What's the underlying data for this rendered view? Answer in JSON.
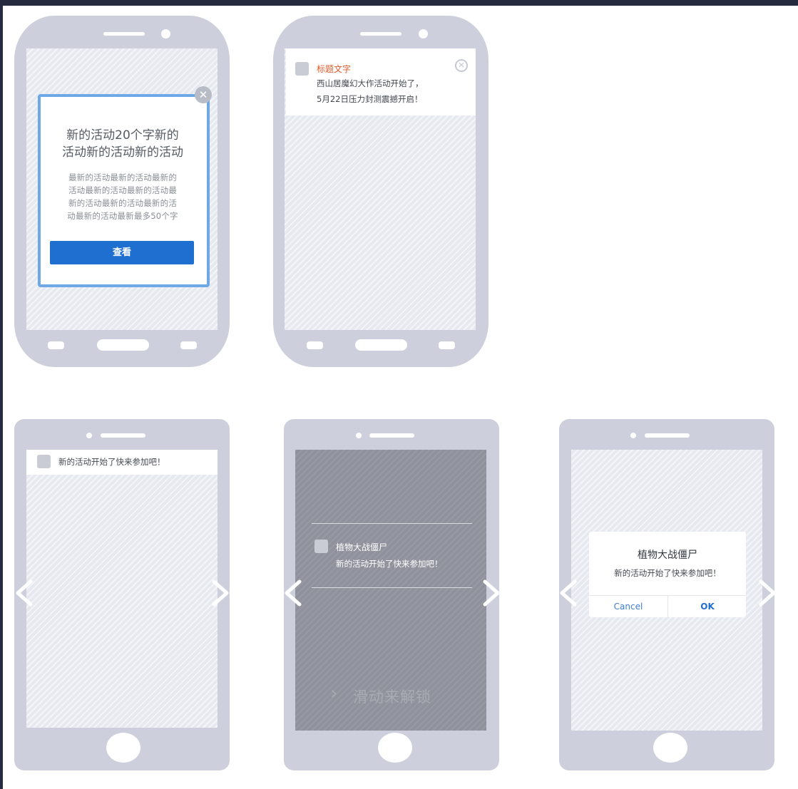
{
  "phone1": {
    "popup_title_line1": "新的活动20个字新的",
    "popup_title_line2": "活动新的活动新的活动",
    "popup_body_line1": "最新的活动最新的活动最新的",
    "popup_body_line2": "活动最新的活动最新的活动最",
    "popup_body_line3": "新的活动最新的活动最新的活",
    "popup_body_line4": "动最新的活动最新最多50个字",
    "view_button": "查看",
    "close_glyph": "✕"
  },
  "phone2": {
    "notification_title": "标题文字",
    "notification_line1": "西山居魔幻大作活动开始了，",
    "notification_line2": "5月22日压力封测震撼开启！",
    "close_glyph": "✕"
  },
  "phone3": {
    "banner_text": "新的活动开始了快来参加吧！"
  },
  "phone4": {
    "notification_title": "植物大战僵尸",
    "notification_message": "新的活动开始了快来参加吧！",
    "slide_to_unlock": "滑动来解锁",
    "slide_chevron": "›"
  },
  "phone5": {
    "dialog_title": "植物大战僵尸",
    "dialog_message": "新的活动开始了快来参加吧！",
    "cancel_label": "Cancel",
    "ok_label": "OK"
  },
  "colors": {
    "frame": "#cdd0dc",
    "popup_border": "#6fa8e6",
    "primary_button": "#1f6fd0",
    "title_accent": "#e15a2b",
    "dark_screen": "#8f929c"
  },
  "icons": [
    "close-icon",
    "app-icon",
    "chevron-left-icon",
    "chevron-right-icon",
    "home-button"
  ]
}
